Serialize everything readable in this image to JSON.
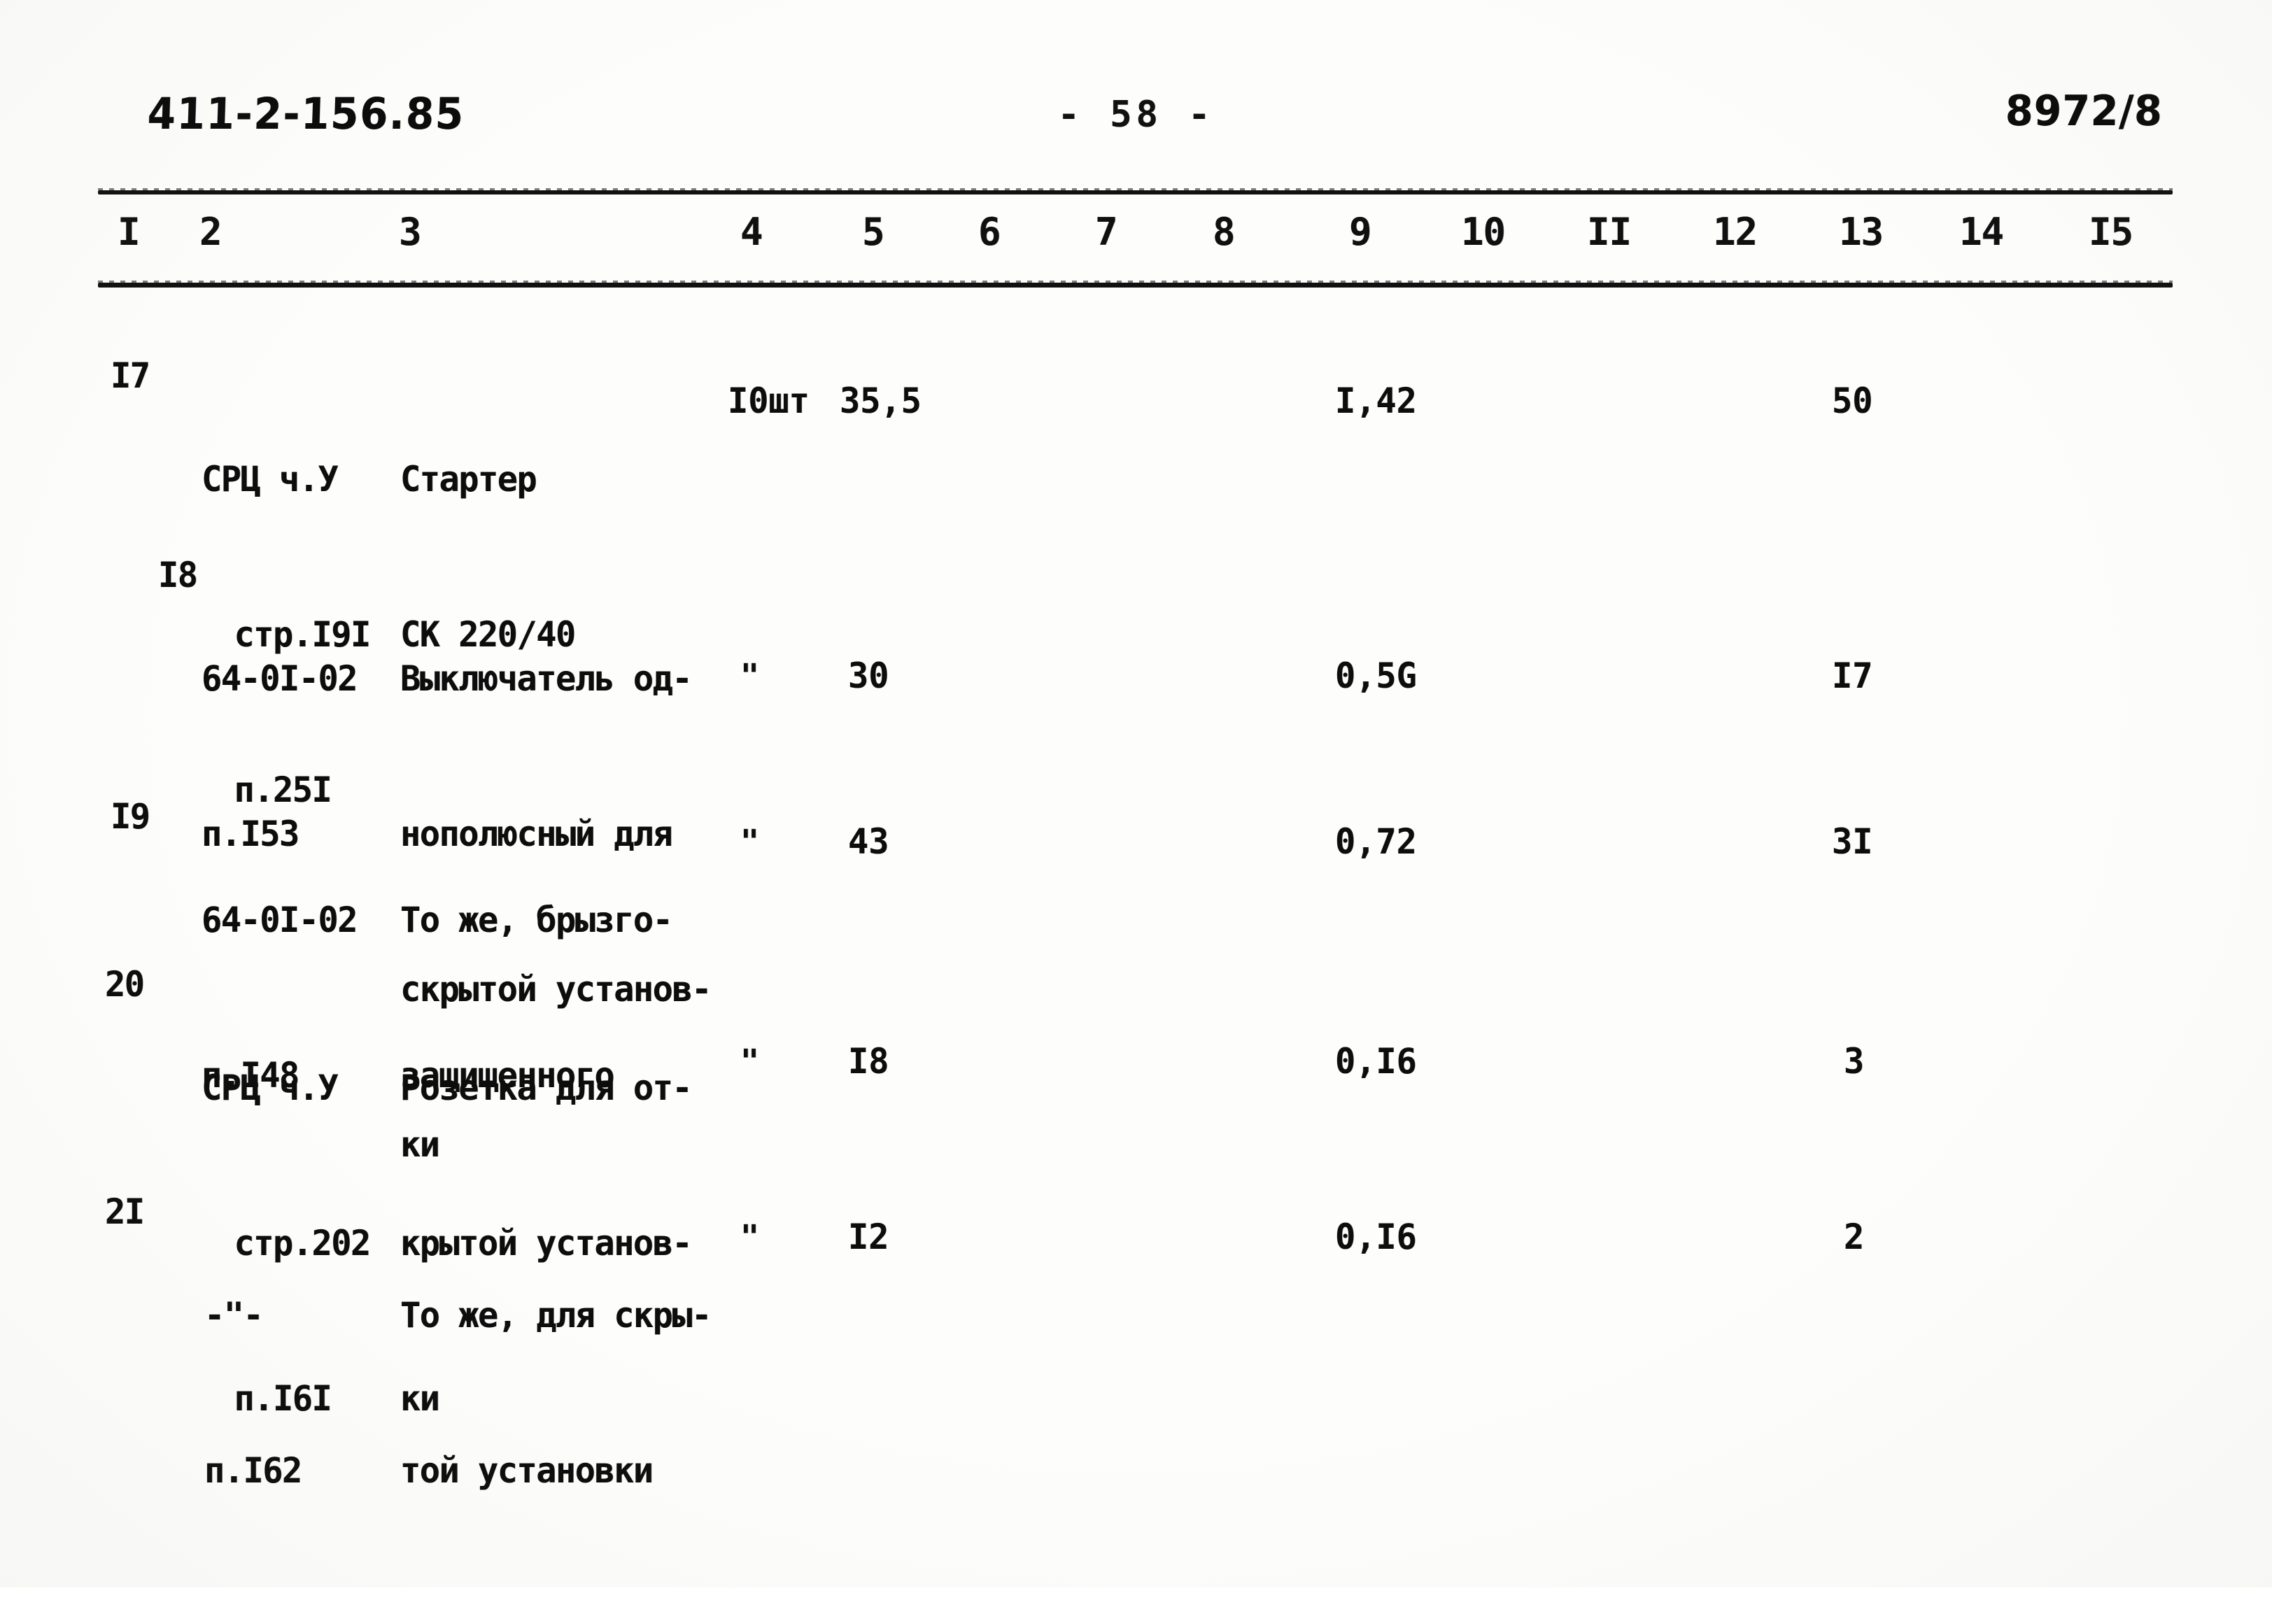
{
  "header": {
    "doc_code": "411-2-156.85",
    "page_number": "- 58 -",
    "sheet_code": "8972/8"
  },
  "table": {
    "column_numbers": [
      "I",
      "2",
      "3",
      "4",
      "5",
      "6",
      "7",
      "8",
      "9",
      "10",
      "II",
      "12",
      "13",
      "14",
      "I5"
    ],
    "rows": [
      {
        "no": "I7",
        "ref": [
          "СРЦ ч.У",
          "стр.I9I",
          "п.25I"
        ],
        "name": [
          "Стартер",
          "СК 220/40"
        ],
        "c4": "I0шт",
        "c5": "35,5",
        "c9": "I,42",
        "c13": "50"
      },
      {
        "no": "I8",
        "ref": [
          "64-0I-02",
          "п.I53"
        ],
        "name": [
          "Выключатель од-",
          "нополюсный для",
          "скрытой установ-",
          "ки"
        ],
        "c4": "\"",
        "c5": "30",
        "c9": "0,5G",
        "c13": "I7"
      },
      {
        "no": "I9",
        "ref": [
          "64-0I-02",
          "п.I48"
        ],
        "name": [
          "То же, брызго-",
          "защищенного"
        ],
        "c4": "\"",
        "c5": "43",
        "c9": "0,72",
        "c13": "3I"
      },
      {
        "no": "20",
        "ref": [
          "СРЦ ч.У",
          "стр.202",
          "п.I6I"
        ],
        "name": [
          "Розетка для от-",
          "крытой установ-",
          "ки"
        ],
        "c4": "\"",
        "c5": "I8",
        "c9": "0,I6",
        "c13": "3"
      },
      {
        "no": "2I",
        "ref": [
          "-\"-",
          "п.I62"
        ],
        "name": [
          "То же, для скры-",
          "той установки"
        ],
        "c4": "\"",
        "c5": "I2",
        "c9": "0,I6",
        "c13": "2"
      }
    ]
  }
}
